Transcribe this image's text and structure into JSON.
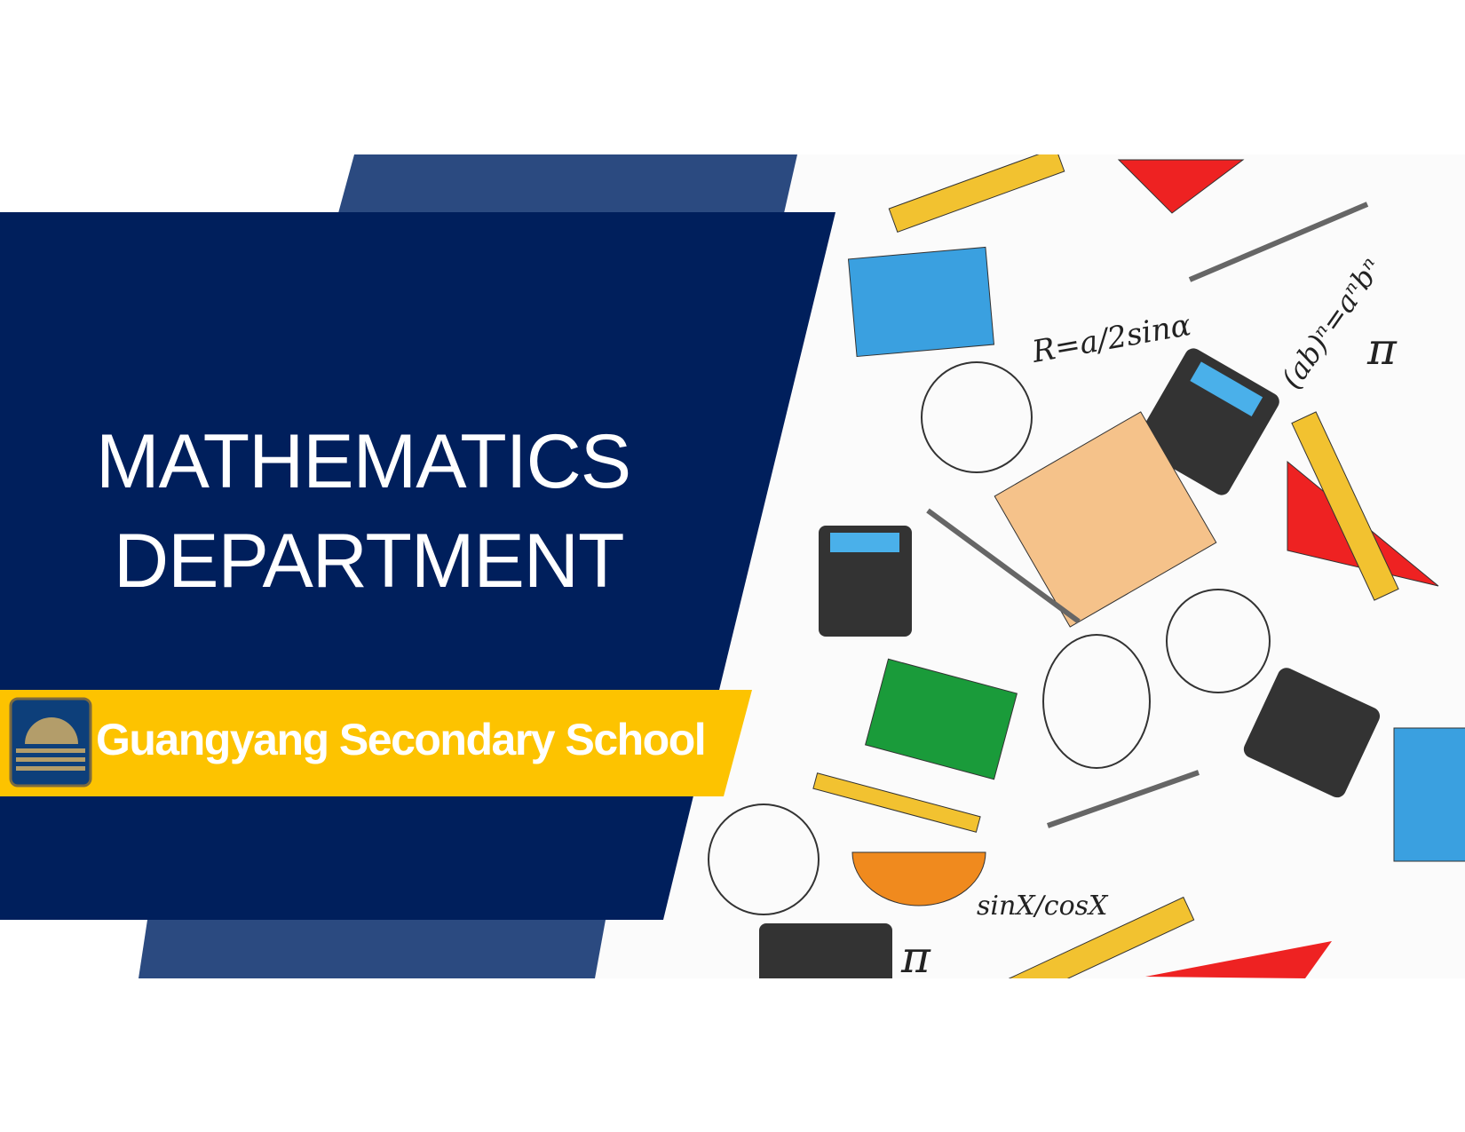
{
  "slide": {
    "title_line1": "MATHEMATICS",
    "title_line2": "DEPARTMENT",
    "school_name": "Guangyang Secondary School"
  },
  "illustration": {
    "formulas": [
      "R=a/2sinα",
      "(ab)ⁿ=aⁿbⁿ",
      "sinX/cosX",
      "π"
    ]
  },
  "colors": {
    "navy": "#001f5c",
    "band_blue": "#2b4a80",
    "yellow": "#fdc300",
    "logo_blue": "#0d3f7a",
    "logo_gold": "#b39d6a"
  }
}
